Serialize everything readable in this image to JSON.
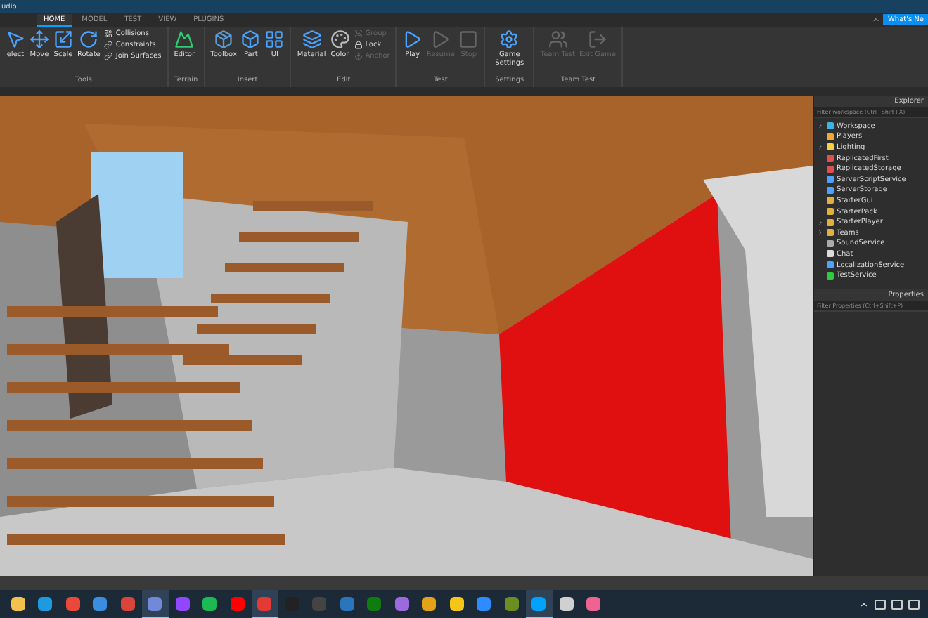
{
  "window": {
    "title": "udio"
  },
  "tabs": [
    {
      "label": "HOME",
      "selected": true
    },
    {
      "label": "MODEL",
      "selected": false
    },
    {
      "label": "TEST",
      "selected": false
    },
    {
      "label": "VIEW",
      "selected": false
    },
    {
      "label": "PLUGINS",
      "selected": false
    }
  ],
  "whats_new": "What's Ne",
  "ribbon": [
    {
      "label": "Tools",
      "items": [
        {
          "kind": "large",
          "label": "elect",
          "disabled": false
        },
        {
          "kind": "large",
          "label": "Move",
          "disabled": false
        },
        {
          "kind": "large",
          "label": "Scale",
          "disabled": false
        },
        {
          "kind": "large",
          "label": "Rotate",
          "disabled": false
        },
        {
          "kind": "small",
          "label": "Collisions",
          "disabled": false
        },
        {
          "kind": "small",
          "label": "Constraints",
          "disabled": false
        },
        {
          "kind": "small",
          "label": "Join Surfaces",
          "disabled": false
        }
      ]
    },
    {
      "label": "Terrain",
      "items": [
        {
          "kind": "large",
          "label": "Editor",
          "disabled": false
        }
      ]
    },
    {
      "label": "Insert",
      "items": [
        {
          "kind": "large",
          "label": "Toolbox",
          "disabled": false
        },
        {
          "kind": "large",
          "label": "Part",
          "disabled": false
        },
        {
          "kind": "large",
          "label": "UI",
          "disabled": false
        }
      ]
    },
    {
      "label": "Edit",
      "items": [
        {
          "kind": "large",
          "label": "Material",
          "disabled": false
        },
        {
          "kind": "large",
          "label": "Color",
          "disabled": false
        },
        {
          "kind": "small",
          "label": "Group",
          "disabled": true
        },
        {
          "kind": "small",
          "label": "Lock",
          "disabled": false
        },
        {
          "kind": "small",
          "label": "Anchor",
          "disabled": true
        }
      ]
    },
    {
      "label": "Test",
      "items": [
        {
          "kind": "large",
          "label": "Play",
          "disabled": false
        },
        {
          "kind": "large",
          "label": "Resume",
          "disabled": true
        },
        {
          "kind": "large",
          "label": "Stop",
          "disabled": true
        }
      ]
    },
    {
      "label": "Settings",
      "items": [
        {
          "kind": "large",
          "label": "Game Settings",
          "disabled": false
        }
      ]
    },
    {
      "label": "Team Test",
      "items": [
        {
          "kind": "large",
          "label": "Team Test",
          "disabled": true
        },
        {
          "kind": "large",
          "label": "Exit Game",
          "disabled": true
        }
      ]
    }
  ],
  "explorer": {
    "title": "Explorer",
    "placeholder": "Filter workspace (Ctrl+Shift+X)",
    "items": [
      {
        "label": "Workspace",
        "expandable": true
      },
      {
        "label": "Players",
        "expandable": false
      },
      {
        "label": "Lighting",
        "expandable": true
      },
      {
        "label": "ReplicatedFirst",
        "expandable": false
      },
      {
        "label": "ReplicatedStorage",
        "expandable": false
      },
      {
        "label": "ServerScriptService",
        "expandable": false
      },
      {
        "label": "ServerStorage",
        "expandable": false
      },
      {
        "label": "StarterGui",
        "expandable": false
      },
      {
        "label": "StarterPack",
        "expandable": false
      },
      {
        "label": "StarterPlayer",
        "expandable": true
      },
      {
        "label": "Teams",
        "expandable": true
      },
      {
        "label": "SoundService",
        "expandable": false
      },
      {
        "label": "Chat",
        "expandable": false
      },
      {
        "label": "LocalizationService",
        "expandable": false
      },
      {
        "label": "TestService",
        "expandable": false
      }
    ]
  },
  "properties": {
    "title": "Properties",
    "placeholder": "Filter Properties (Ctrl+Shift+P)"
  },
  "taskbar": [
    {
      "color": "#f2c14e",
      "selected": false
    },
    {
      "color": "#1e9be0",
      "selected": false
    },
    {
      "color": "#e9483b",
      "selected": false
    },
    {
      "color": "#3b8de0",
      "selected": false
    },
    {
      "color": "#d9453a",
      "selected": false
    },
    {
      "color": "#7289da",
      "selected": true
    },
    {
      "color": "#9146ff",
      "selected": false
    },
    {
      "color": "#1db954",
      "selected": false
    },
    {
      "color": "#ff0000",
      "selected": false
    },
    {
      "color": "#e53935",
      "selected": true
    },
    {
      "color": "#222222",
      "selected": false
    },
    {
      "color": "#444444",
      "selected": false
    },
    {
      "color": "#2a75bb",
      "selected": false
    },
    {
      "color": "#107c10",
      "selected": false
    },
    {
      "color": "#9c6ade",
      "selected": false
    },
    {
      "color": "#e3a317",
      "selected": false
    },
    {
      "color": "#f5c518",
      "selected": false
    },
    {
      "color": "#2d8cff",
      "selected": false
    },
    {
      "color": "#6b8e23",
      "selected": false
    },
    {
      "color": "#00a2ff",
      "selected": true
    },
    {
      "color": "#d0d0d0",
      "selected": false
    },
    {
      "color": "#f06292",
      "selected": false
    }
  ]
}
